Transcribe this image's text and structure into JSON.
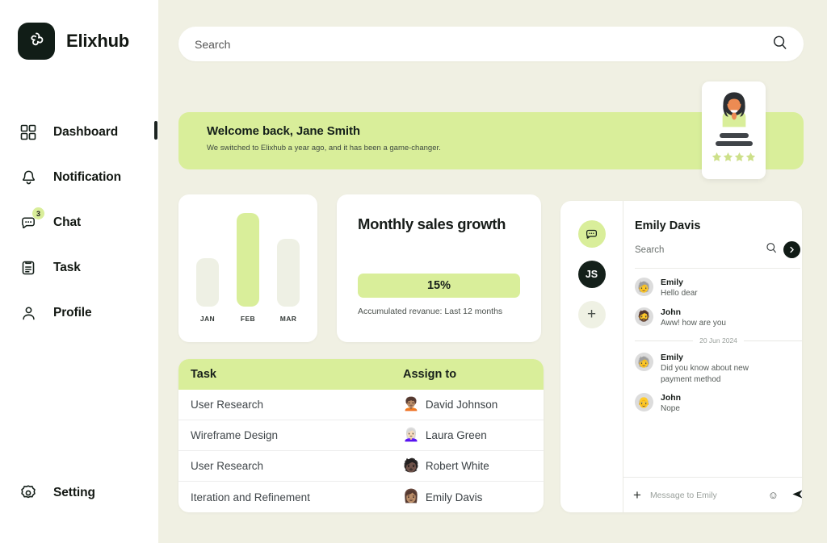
{
  "brand": {
    "name": "Elixhub",
    "logo_icon": "pinwheel-logo-icon"
  },
  "colors": {
    "accent_green": "#D9EE9A",
    "background": "#F0F0E3",
    "dark": "#14201A",
    "card": "#FFFFFF"
  },
  "sidebar": {
    "items": [
      {
        "label": "Dashboard",
        "icon": "grid-icon",
        "active": true,
        "badge": ""
      },
      {
        "label": "Notification",
        "icon": "bell-icon",
        "active": false,
        "badge": ""
      },
      {
        "label": "Chat",
        "icon": "chat-bubble-icon",
        "active": false,
        "badge": "3"
      },
      {
        "label": "Task",
        "icon": "clipboard-icon",
        "active": false,
        "badge": ""
      },
      {
        "label": "Profile",
        "icon": "user-icon",
        "active": false,
        "badge": ""
      }
    ],
    "bottom": {
      "label": "Setting",
      "icon": "gear-icon"
    }
  },
  "search": {
    "value": "",
    "placeholder": "Search",
    "icon": "search-icon"
  },
  "welcome": {
    "title": "Welcome back, Jane Smith",
    "subtitle": "We switched to Elixhub a year ago, and it has been a game-changer."
  },
  "testimonial": {
    "avatar_icon": "woman-avatar-icon",
    "stars": 4
  },
  "chart_data": {
    "type": "bar",
    "title": "",
    "categories": [
      "JAN",
      "FEB",
      "MAR"
    ],
    "values": [
      52,
      100,
      72
    ],
    "highlight_index": 1,
    "xlabel": "",
    "ylabel": "",
    "ylim": [
      0,
      100
    ],
    "grid": false,
    "legend": "none"
  },
  "sales": {
    "title": "Monthly sales growth",
    "percent": "15%",
    "footnote": "Accumulated revanue: Last 12 months"
  },
  "tasks": {
    "columns": [
      "Task",
      "Assign to"
    ],
    "rows": [
      {
        "task": "User Research",
        "assignee": "David Johnson",
        "avatar": "🧑🏽‍🦱"
      },
      {
        "task": "Wireframe Design",
        "assignee": "Laura Green",
        "avatar": "👩🏻‍🦳"
      },
      {
        "task": "User Research",
        "assignee": "Robert White",
        "avatar": "🧑🏿"
      },
      {
        "task": "Iteration and Refinement",
        "assignee": "Emily Davis",
        "avatar": "👩🏽"
      }
    ]
  },
  "chat": {
    "rail": [
      {
        "name": "chat-bubble-icon",
        "label": ""
      },
      {
        "name": "avatar-js",
        "label": "JS"
      },
      {
        "name": "plus-icon",
        "label": "+"
      }
    ],
    "title": "Emily Davis",
    "search": {
      "value": "",
      "placeholder": "Search",
      "icon": "search-icon"
    },
    "next_icon": "chevron-right-icon",
    "messages_top": [
      {
        "sender": "Emily",
        "text": "Hello dear",
        "avatar": "🧓"
      },
      {
        "sender": "John",
        "text": "Aww! how are you",
        "avatar": "🧔"
      }
    ],
    "date_divider": "20 Jun 2024",
    "messages_bottom": [
      {
        "sender": "Emily",
        "text": "Did you know about new payment method",
        "avatar": "🧓"
      },
      {
        "sender": "John",
        "text": "Nope",
        "avatar": "👴"
      }
    ],
    "composer": {
      "plus_icon": "plus-icon",
      "value": "",
      "placeholder": "Message to Emily",
      "emoji_icon": "smiley-icon",
      "send_icon": "send-icon"
    }
  }
}
